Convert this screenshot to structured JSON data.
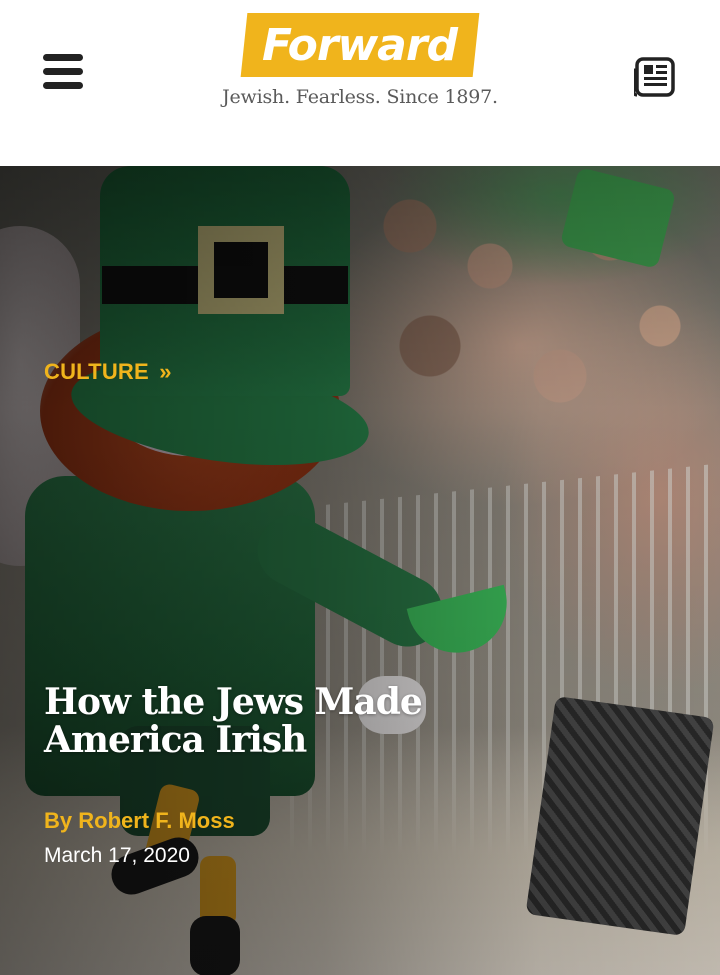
{
  "colors": {
    "brand_yellow": "#F0B41C",
    "ink": "#222222",
    "tagline_gray": "#5A5A5A",
    "headline_white": "#FFFFFF"
  },
  "header": {
    "menu_icon": "hamburger-menu-icon",
    "logo_text": "Forward",
    "tagline": "Jewish. Fearless. Since 1897.",
    "right_icon": "newspaper-icon"
  },
  "article": {
    "category": "CULTURE",
    "category_chevron": "»",
    "title_line1": "How the Jews Made",
    "title_line2": "America Irish",
    "byline_prefix": "By",
    "author": "Robert F. Moss",
    "date": "March 17, 2020"
  }
}
